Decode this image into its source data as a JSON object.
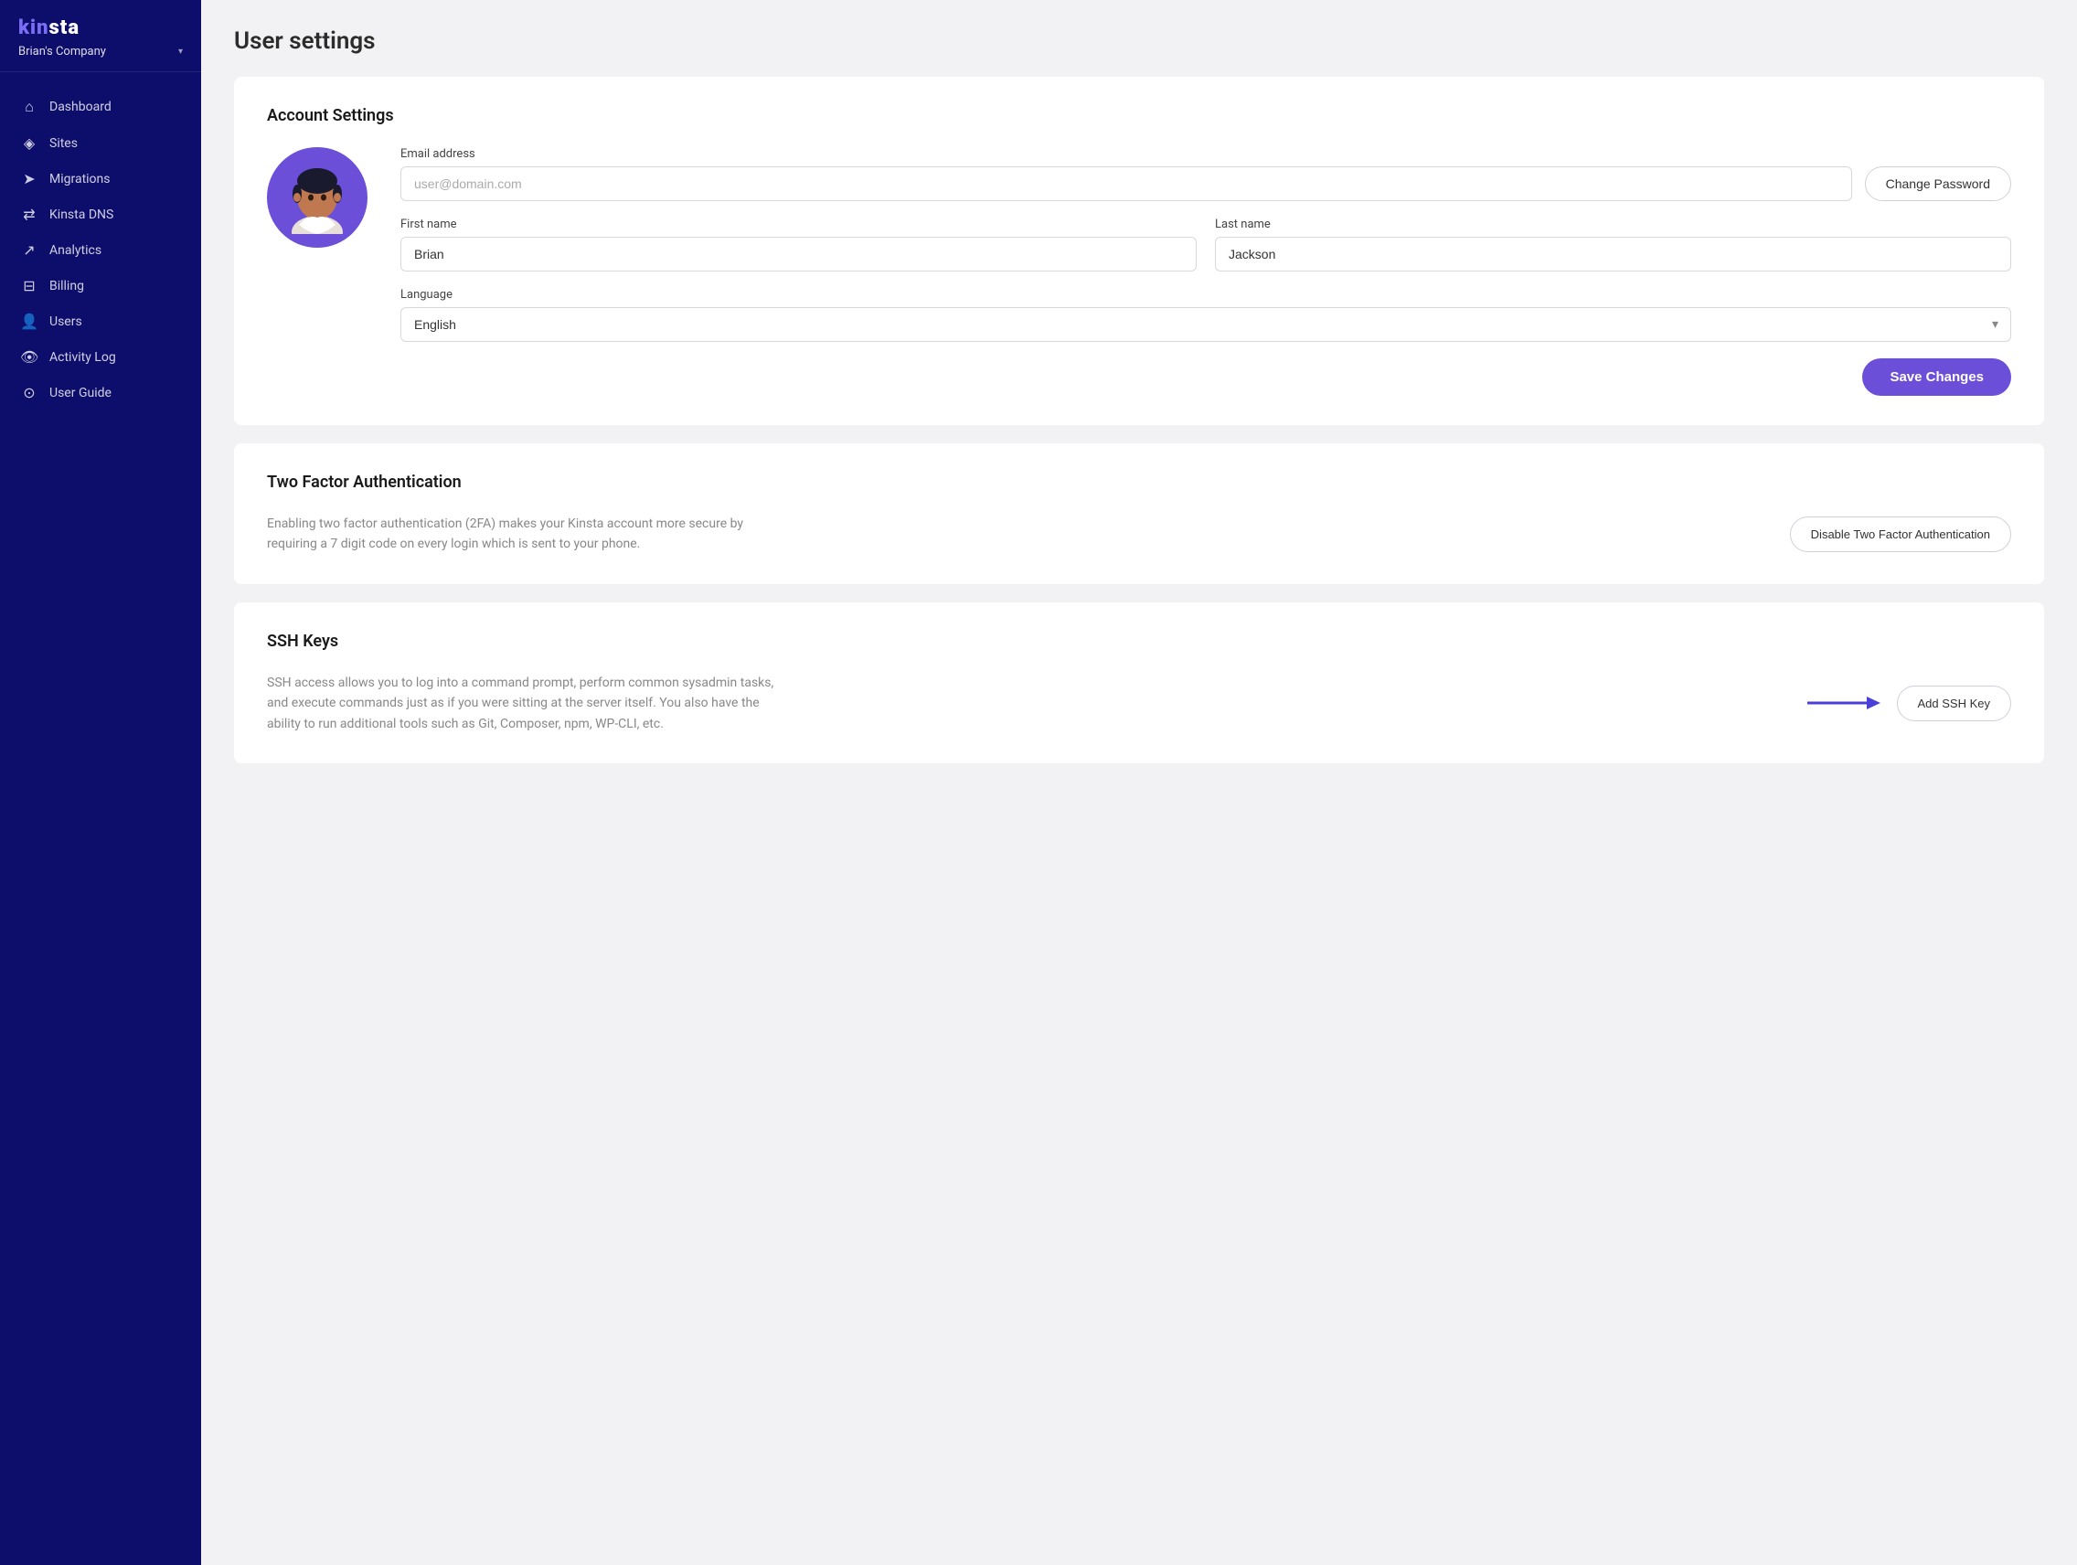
{
  "sidebar": {
    "logo": "kinsta",
    "company": "Brian's Company",
    "nav": [
      {
        "id": "dashboard",
        "label": "Dashboard",
        "icon": "⌂"
      },
      {
        "id": "sites",
        "label": "Sites",
        "icon": "◈"
      },
      {
        "id": "migrations",
        "label": "Migrations",
        "icon": "➤"
      },
      {
        "id": "kinsta-dns",
        "label": "Kinsta DNS",
        "icon": "⇄"
      },
      {
        "id": "analytics",
        "label": "Analytics",
        "icon": "↗"
      },
      {
        "id": "billing",
        "label": "Billing",
        "icon": "⊟"
      },
      {
        "id": "users",
        "label": "Users",
        "icon": "👤"
      },
      {
        "id": "activity-log",
        "label": "Activity Log",
        "icon": "👁"
      },
      {
        "id": "user-guide",
        "label": "User Guide",
        "icon": "⊙"
      }
    ]
  },
  "page": {
    "title": "User settings"
  },
  "account_settings": {
    "section_title": "Account Settings",
    "email_label": "Email address",
    "email_placeholder": "user@domain.com",
    "change_password_label": "Change Password",
    "first_name_label": "First name",
    "first_name_value": "Brian",
    "last_name_label": "Last name",
    "last_name_value": "Jackson",
    "language_label": "Language",
    "language_value": "English",
    "save_label": "Save Changes"
  },
  "two_factor": {
    "section_title": "Two Factor Authentication",
    "description": "Enabling two factor authentication (2FA) makes your Kinsta account more secure by requiring a 7 digit code on every login which is sent to your phone.",
    "disable_label": "Disable Two Factor Authentication"
  },
  "ssh_keys": {
    "section_title": "SSH Keys",
    "description": "SSH access allows you to log into a command prompt, perform common sysadmin tasks, and execute commands just as if you were sitting at the server itself. You also have the ability to run additional tools such as Git, Composer, npm, WP-CLI, etc.",
    "add_label": "Add SSH Key"
  }
}
